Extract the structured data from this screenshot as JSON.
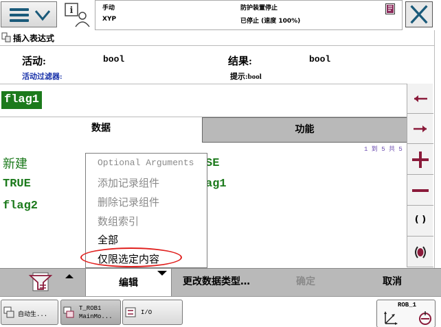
{
  "status": {
    "mode": "手动",
    "robot": "XYP",
    "guard_state": "防护装置停止",
    "speed_state": "已停止 (速度 100%)"
  },
  "title": "插入表达式",
  "info": {
    "active_label": "活动:",
    "active_value": "bool",
    "result_label": "结果:",
    "result_value": "bool",
    "filter_label": "活动过滤器:",
    "hint": "提示:bool"
  },
  "expression": "flag1",
  "tabs": [
    "数据",
    "功能"
  ],
  "page_count": "1 到 5 共 5",
  "list_items": [
    "新建",
    "TRUE",
    "flag2",
    "SE",
    "ag1"
  ],
  "popup_menu": [
    {
      "label": "Optional Arguments",
      "enabled": false
    },
    {
      "label": "添加记录组件",
      "enabled": false
    },
    {
      "label": "删除记录组件",
      "enabled": false
    },
    {
      "label": "数组索引",
      "enabled": false
    },
    {
      "label": "全部",
      "enabled": true
    },
    {
      "label": "仅限选定内容",
      "enabled": true
    }
  ],
  "right_buttons": [
    {
      "icon": "arrow-left-icon"
    },
    {
      "icon": "arrow-right-icon"
    },
    {
      "icon": "plus-icon"
    },
    {
      "icon": "minus-icon"
    },
    {
      "icon": "parentheses-icon",
      "glyph": "( )"
    },
    {
      "icon": "parenthesis-fill-icon"
    }
  ],
  "bottom": {
    "edit": "编辑",
    "change_type": "更改数据类型…",
    "ok": "确定",
    "cancel": "取消"
  },
  "taskbar": {
    "task0": "自动生...",
    "task1_line1": "T_ROB1",
    "task1_line2": "MainMo...",
    "task2": "I/O",
    "robot_unit": "ROB_1"
  },
  "colors": {
    "accent_green": "#1c7a1c",
    "highlight_circle": "#e0201e",
    "filter_blue": "#1a33aa",
    "page_count_purple": "#6b4bb0"
  }
}
